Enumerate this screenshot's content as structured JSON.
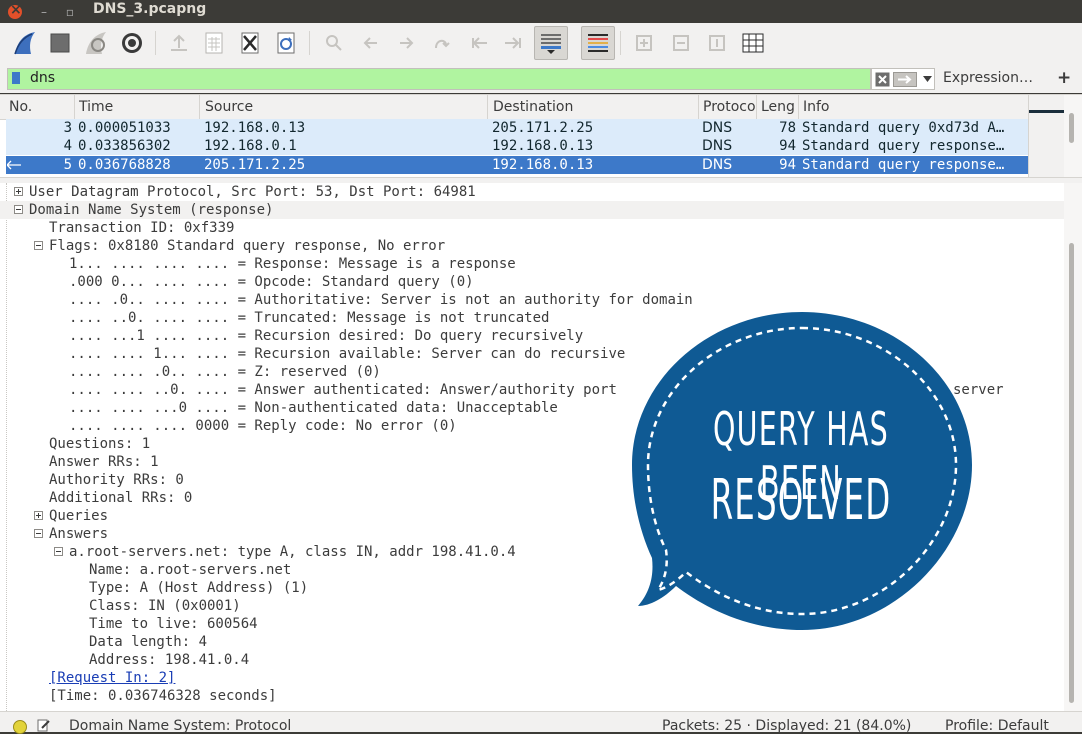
{
  "window": {
    "title": "DNS_3.pcapng"
  },
  "toolbar": {
    "icons": [
      "shark-fin-start-icon",
      "stop-square-icon",
      "restart-fin-icon",
      "gear-options-icon",
      "open-folder-icon",
      "file-grid-icon",
      "close-file-icon",
      "reload-icon",
      "search-icon",
      "go-back-icon",
      "go-forward-icon",
      "go-to-packet-icon",
      "first-packet-icon",
      "last-packet-icon",
      "autoscroll-icon",
      "colorize-icon",
      "zoom-in-icon",
      "zoom-out-icon",
      "normal-size-icon",
      "resize-columns-icon"
    ]
  },
  "filter": {
    "value": "dns",
    "expression_label": "Expression…",
    "add_label": "+"
  },
  "packet_list": {
    "columns": [
      "No.",
      "Time",
      "Source",
      "Destination",
      "Protocol",
      "Length",
      "Info"
    ],
    "columns_shown": [
      "No.",
      "Time",
      "Source",
      "Destination",
      "Protoco",
      "Leng",
      "Info"
    ],
    "rows": [
      {
        "no": "3",
        "time": "0.000051033",
        "src": "192.168.0.13",
        "dst": "205.171.2.25",
        "proto": "DNS",
        "len": "78",
        "info": "Standard query 0xd73d A…"
      },
      {
        "no": "4",
        "time": "0.033856302",
        "src": "192.168.0.1",
        "dst": "192.168.0.13",
        "proto": "DNS",
        "len": "94",
        "info": "Standard query response…"
      },
      {
        "no": "5",
        "time": "0.036768828",
        "src": "205.171.2.25",
        "dst": "192.168.0.13",
        "proto": "DNS",
        "len": "94",
        "info": "Standard query response…",
        "selected": true
      }
    ]
  },
  "details": [
    "User Datagram Protocol, Src Port: 53, Dst Port: 64981",
    "Domain Name System (response)",
    "Transaction ID: 0xf339",
    "Flags: 0x8180 Standard query response, No error",
    "1... .... .... .... = Response: Message is a response",
    ".000 0... .... .... = Opcode: Standard query (0)",
    ".... .0.. .... .... = Authoritative: Server is not an authority for domain",
    ".... ..0. .... .... = Truncated: Message is not truncated",
    ".... ...1 .... .... = Recursion desired: Do query recursively",
    ".... .... 1... .... = Recursion available: Server can do recursive",
    ".... .... .0.. .... = Z: reserved (0)",
    ".... .... ..0. .... = Answer authenticated: Answer/authority port",
    ".... .... ...0 .... = Non-authenticated data: Unacceptable",
    ".... .... .... 0000 = Reply code: No error (0)",
    "Questions: 1",
    "Answer RRs: 1",
    "Authority RRs: 0",
    "Additional RRs: 0",
    "Queries",
    "Answers",
    "a.root-servers.net: type A, class IN, addr 198.41.0.4",
    "Name: a.root-servers.net",
    "Type: A (Host Address) (1)",
    "Class: IN (0x0001)",
    "Time to live: 600564",
    "Data length: 4",
    "Address: 198.41.0.4",
    "[Request In: 2]",
    "[Time: 0.036746328 seconds]"
  ],
  "details_extra": {
    "server_fragment": "server"
  },
  "status": {
    "protocol_text": "Domain Name System: Protocol",
    "packets_text": "Packets: 25 · Displayed: 21 (84.0%)",
    "profile_text": "Profile: Default"
  },
  "badge": {
    "line1": "QUERY HAS BEEN",
    "line2": "RESOLVED",
    "color": "#0f5a94"
  },
  "colors": {
    "selected_row": "#3d79c9",
    "dns_row": "#dcebfa",
    "filter_valid": "#b0f4a0"
  }
}
